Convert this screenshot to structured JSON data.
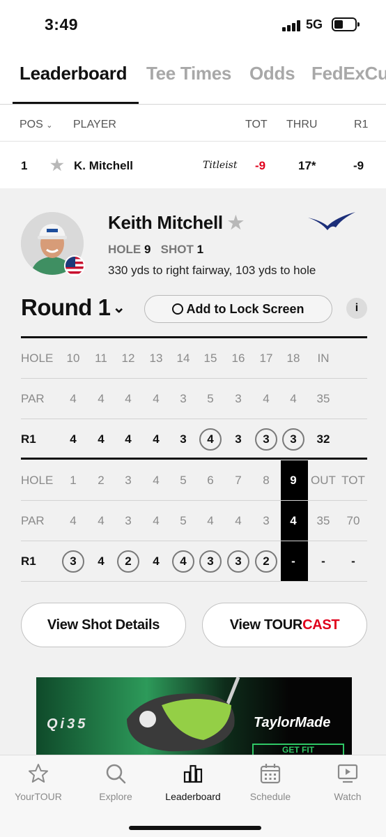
{
  "status": {
    "time": "3:49",
    "network": "5G"
  },
  "tabs": [
    {
      "label": "Leaderboard",
      "active": true
    },
    {
      "label": "Tee Times",
      "active": false
    },
    {
      "label": "Odds",
      "active": false
    },
    {
      "label": "FedExCu",
      "active": false
    }
  ],
  "columns": {
    "pos": "POS",
    "player": "PLAYER",
    "tot": "TOT",
    "thru": "THRU",
    "r1": "R1"
  },
  "player_row": {
    "pos": "1",
    "name": "K. Mitchell",
    "sponsor": "Titleist",
    "tot": "-9",
    "thru": "17*",
    "r1": "-9"
  },
  "detail": {
    "full_name": "Keith Mitchell",
    "hole_label": "HOLE",
    "hole_value": "9",
    "shot_label": "SHOT",
    "shot_value": "1",
    "shot_description": "330 yds to right fairway, 103 yds to hole",
    "round_label": "Round 1",
    "lock_screen_label": "Add to Lock Screen",
    "info_label": "i"
  },
  "scorecard": {
    "back_nine": {
      "hole_label": "HOLE",
      "holes": [
        "10",
        "11",
        "12",
        "13",
        "14",
        "15",
        "16",
        "17",
        "18"
      ],
      "total_label": "IN",
      "par_label": "PAR",
      "par": [
        "4",
        "4",
        "4",
        "4",
        "3",
        "5",
        "3",
        "4",
        "4"
      ],
      "par_total": "35",
      "round_label": "R1",
      "scores": [
        "4",
        "4",
        "4",
        "4",
        "3",
        "4",
        "3",
        "3",
        "3"
      ],
      "circled": [
        false,
        false,
        false,
        false,
        false,
        true,
        false,
        true,
        true
      ],
      "score_total": "32"
    },
    "front_nine": {
      "hole_label": "HOLE",
      "holes": [
        "1",
        "2",
        "3",
        "4",
        "5",
        "6",
        "7",
        "8",
        "9"
      ],
      "out_label": "OUT",
      "tot_label": "TOT",
      "par_label": "PAR",
      "par": [
        "4",
        "4",
        "3",
        "4",
        "5",
        "4",
        "4",
        "3",
        "4"
      ],
      "par_out": "35",
      "par_tot": "70",
      "round_label": "R1",
      "scores": [
        "3",
        "4",
        "2",
        "4",
        "4",
        "3",
        "3",
        "2",
        "-"
      ],
      "circled": [
        true,
        false,
        true,
        false,
        true,
        true,
        true,
        true,
        false
      ],
      "score_out": "-",
      "score_tot": "-",
      "current_hole_index": 8
    }
  },
  "buttons": {
    "shot_details": "View Shot Details",
    "tourcast_prefix": "View TOUR",
    "tourcast_suffix": "CAST"
  },
  "ad": {
    "product": "Qi35",
    "brand": "TaylorMade",
    "cta": "GET FIT"
  },
  "bottom_nav": [
    {
      "label": "YourTOUR",
      "icon": "star-icon"
    },
    {
      "label": "Explore",
      "icon": "search-icon"
    },
    {
      "label": "Leaderboard",
      "icon": "leaderboard-icon",
      "active": true
    },
    {
      "label": "Schedule",
      "icon": "calendar-icon"
    },
    {
      "label": "Watch",
      "icon": "play-icon"
    }
  ],
  "colors": {
    "accent_red": "#e0001b",
    "panel_bg": "#f1f1f1",
    "mizuno_blue": "#1c2f7a"
  }
}
